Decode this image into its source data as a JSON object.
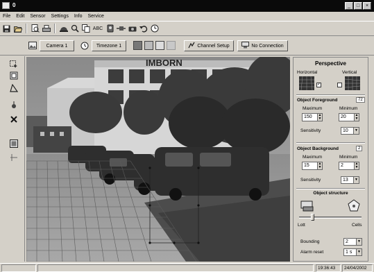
{
  "window": {
    "title": "0",
    "minimize": "_",
    "maximize": "□",
    "close": "×"
  },
  "menu": [
    "File",
    "Edit",
    "Sensor",
    "Settings",
    "Info",
    "Service"
  ],
  "toolbar": {
    "icons": [
      "save-icon",
      "open-icon",
      "print-preview-icon",
      "print-icon",
      "helmet-icon",
      "magnifier-icon",
      "copy-icon",
      "abc-icon",
      "sensor-icon",
      "network-icon",
      "camera-icon",
      "undo-icon",
      "clock-icon"
    ],
    "abc_label": "ABC"
  },
  "toolbar2": {
    "camera_label": "Camera 1",
    "timezone_label": "Timezone 1",
    "channel_setup_label": "Channel Setup",
    "no_connection_label": "No Connection"
  },
  "video": {
    "building_sign": "IMBORN"
  },
  "panel": {
    "title": "Perspective",
    "horizontal_label": "Horizontal",
    "vertical_label": "Vertical",
    "horizontal_checked": true,
    "vertical_checked": false,
    "foreground": {
      "title": "Object Foreground",
      "badge": "72",
      "maximum_label": "Maximum",
      "minimum_label": "Minimum",
      "maximum_value": "150",
      "minimum_value": "20",
      "sensitivity_label": "Sensitivity",
      "sensitivity_value": "10"
    },
    "background": {
      "title": "Object Background",
      "badge": "2",
      "maximum_label": "Maximum",
      "minimum_label": "Minimum",
      "maximum_value": "15",
      "minimum_value": "2",
      "sensitivity_label": "Sensitivity",
      "sensitivity_value": "13"
    },
    "structure": {
      "title": "Object structure",
      "left_label": "Lott",
      "right_label": "Cells",
      "slider_fraction": 0.2,
      "bounding_label": "Bounding",
      "bounding_value": "2",
      "alarm_reset_label": "Alarm reset",
      "alarm_reset_value": "1 s"
    }
  },
  "status": {
    "time": "19:36:43",
    "date": "24/04/2002"
  }
}
